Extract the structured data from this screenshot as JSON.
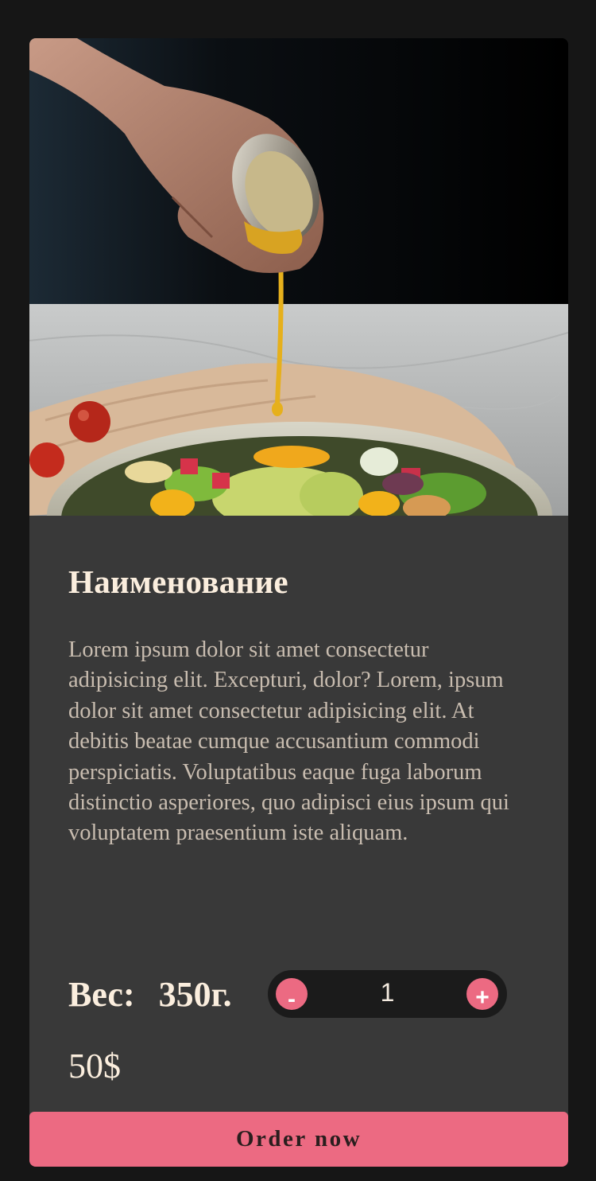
{
  "product": {
    "title": "Наименование",
    "description": "Lorem ipsum dolor sit amet consectetur adipisicing elit. Excepturi, dolor? Lorem, ipsum dolor sit amet consectetur adipisicing elit. At debitis beatae cumque accusantium commodi perspiciatis. Voluptatibus eaque fuga laborum distinctio asperiores, quo adipisci eius ipsum qui voluptatem praesentium iste aliquam.",
    "weight_label": "Вес:",
    "weight_value": "350г.",
    "price": "50$"
  },
  "stepper": {
    "minus_label": "-",
    "quantity": "1",
    "plus_label": "+"
  },
  "actions": {
    "order_label": "Order now"
  },
  "colors": {
    "page_background": "#161616",
    "card_background": "#393939",
    "accent": "#ec6a82",
    "title_text": "#fbeede",
    "body_text": "#c9bdb0",
    "stepper_background": "#1b1b1b"
  },
  "image": {
    "subject": "hand pouring dressing over salad bowl"
  }
}
